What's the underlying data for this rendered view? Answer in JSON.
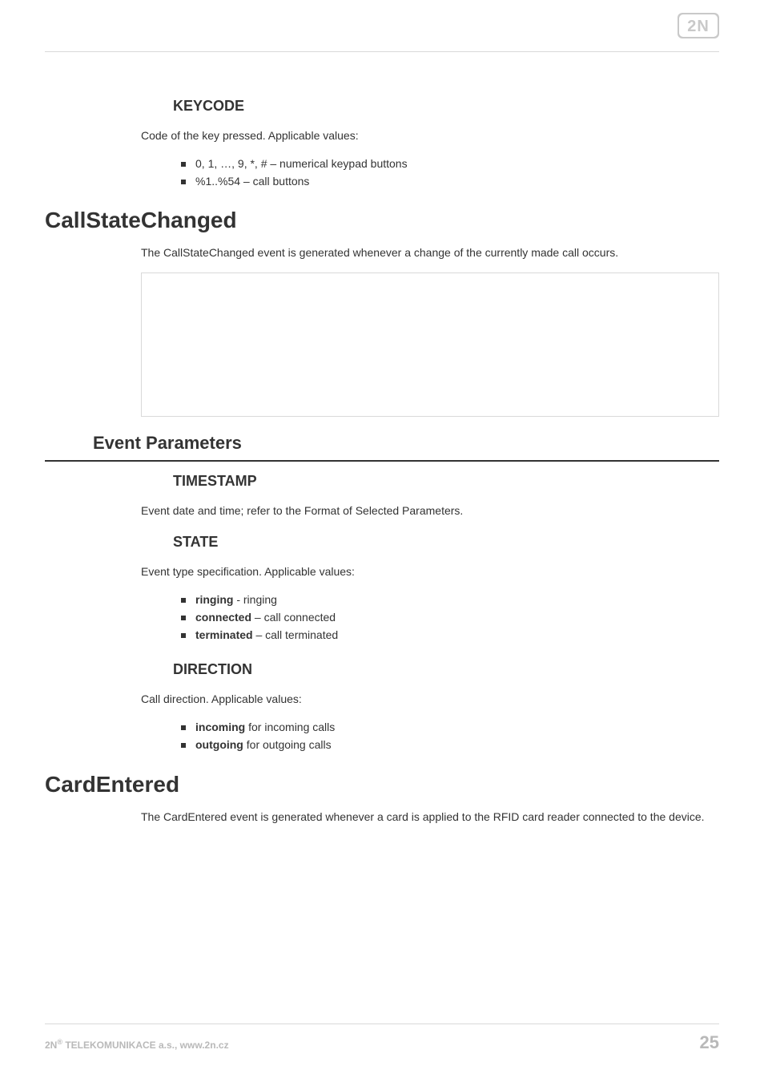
{
  "logo_alt": "2N",
  "sec_keycode": {
    "heading": "KEYCODE",
    "text": "Code of the key pressed. Applicable values:",
    "bullets": [
      "0, 1, …, 9, *, # – numerical keypad buttons",
      "%1..%54 – call buttons"
    ]
  },
  "sec_callstate": {
    "heading": "CallStateChanged",
    "text": "The CallStateChanged event is generated whenever a change of the currently made call occurs."
  },
  "sec_eventparams": {
    "heading": "Event Parameters"
  },
  "sec_timestamp": {
    "heading": "TIMESTAMP",
    "text": "Event date and time; refer to the Format of Selected Parameters."
  },
  "sec_state": {
    "heading": "STATE",
    "text": "Event type specification. Applicable values:",
    "bullets": [
      {
        "bold": "ringing",
        "rest": " - ringing"
      },
      {
        "bold": "connected",
        "rest": " – call connected"
      },
      {
        "bold": "terminated",
        "rest": " – call terminated"
      }
    ]
  },
  "sec_direction": {
    "heading": "DIRECTION",
    "text": "Call direction. Applicable values:",
    "bullets": [
      {
        "bold": "incoming",
        "rest": " for incoming calls"
      },
      {
        "bold": "outgoing",
        "rest": " for outgoing calls"
      }
    ]
  },
  "sec_cardentered": {
    "heading": "CardEntered",
    "text": "The CardEntered event is generated whenever a card is applied to the RFID card reader connected to the device."
  },
  "footer": {
    "left_prefix": "2N",
    "left_sup": "®",
    "left_rest": " TELEKOMUNIKACE a.s., www.2n.cz",
    "page": "25"
  }
}
